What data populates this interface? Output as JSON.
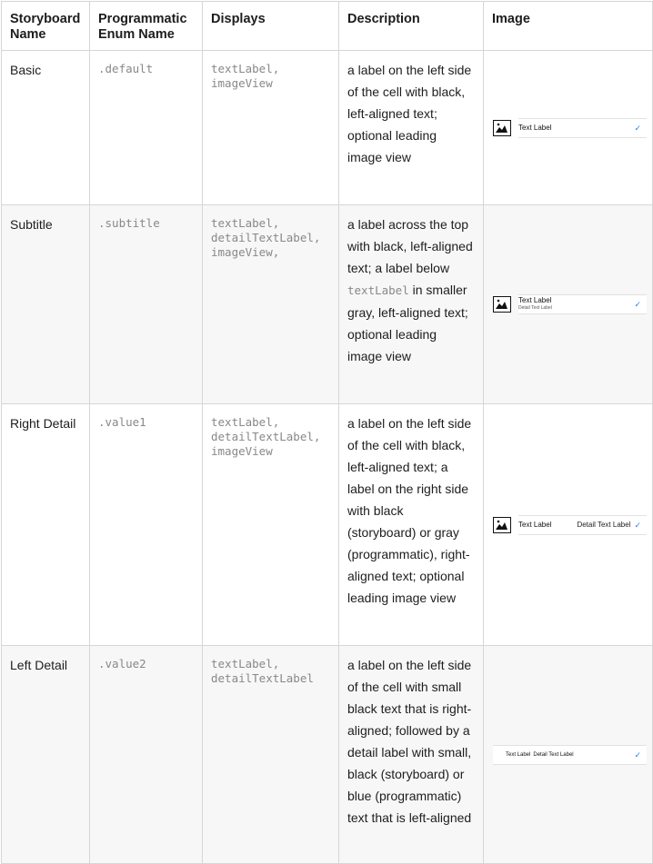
{
  "headers": [
    "Storyboard Name",
    "Programmatic Enum Name",
    "Displays",
    "Description",
    "Image"
  ],
  "rows": [
    {
      "name": "Basic",
      "enum": ".default",
      "displays": "textLabel,\nimageView",
      "desc_pre": "a label on the left side of the cell with black, left-aligned text; optional leading image view",
      "desc_code": "",
      "desc_post": "",
      "mock": {
        "text": "Text Label",
        "detail": "",
        "check": "✓"
      }
    },
    {
      "name": "Subtitle",
      "enum": ".subtitle",
      "displays": "textLabel,\ndetailTextLabel,\nimageView,",
      "desc_pre": "a label across the top with black, left-aligned text; a label below ",
      "desc_code": "textLabel",
      "desc_post": " in smaller gray, left-aligned text; optional leading image view",
      "mock": {
        "text": "Text Label",
        "detail": "Detail Text Label",
        "check": "✓"
      }
    },
    {
      "name": "Right Detail",
      "enum": ".value1",
      "displays": "textLabel,\ndetailTextLabel,\nimageView",
      "desc_pre": "a label on the left side of the cell with black, left-aligned text; a label on the right side with black (storyboard) or gray (programmatic), right-aligned text; optional leading image view",
      "desc_code": "",
      "desc_post": "",
      "mock": {
        "text": "Text Label",
        "detail": "Detail Text Label",
        "check": "✓"
      }
    },
    {
      "name": "Left Detail",
      "enum": ".value2",
      "displays": "textLabel,\ndetailTextLabel",
      "desc_pre": "a label on the left side of the cell with small black text that is right-aligned; followed by a detail label with small, black (storyboard) or blue (programmatic) text that is left-aligned",
      "desc_code": "",
      "desc_post": "",
      "mock": {
        "text": "Text Label",
        "detail": "Detail Text Label",
        "check": "✓"
      }
    }
  ],
  "colors": {
    "border": "#d6d6d6",
    "alt_row": "#f7f7f7",
    "code": "#888888",
    "checkmark": "#2b7cf6"
  },
  "icons": {
    "thumbnail": "image-placeholder-icon",
    "accessory": "checkmark-icon"
  }
}
